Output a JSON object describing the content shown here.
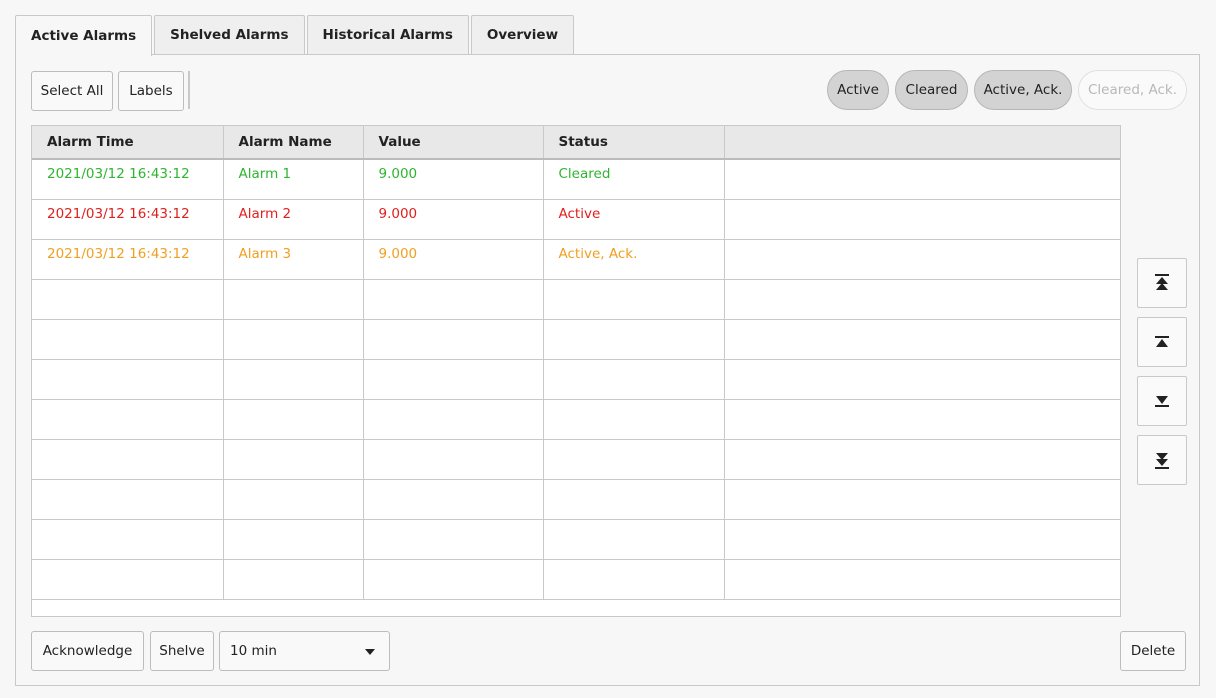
{
  "tabs": [
    "Active Alarms",
    "Shelved Alarms",
    "Historical Alarms",
    "Overview"
  ],
  "toolbar": {
    "select_all": "Select All",
    "labels": "Labels"
  },
  "filters": [
    {
      "label": "Active",
      "enabled": true
    },
    {
      "label": "Cleared",
      "enabled": true
    },
    {
      "label": "Active, Ack.",
      "enabled": true
    },
    {
      "label": "Cleared, Ack.",
      "enabled": false
    }
  ],
  "table": {
    "columns": [
      "Alarm Time",
      "Alarm Name",
      "Value",
      "Status",
      ""
    ],
    "rows": [
      {
        "cells": [
          "2021/03/12 16:43:12",
          "Alarm 1",
          "9.000",
          "Cleared"
        ],
        "color": "#2fb52f"
      },
      {
        "cells": [
          "2021/03/12 16:43:12",
          "Alarm 2",
          "9.000",
          "Active"
        ],
        "color": "#e0201e"
      },
      {
        "cells": [
          "2021/03/12 16:43:12",
          "Alarm 3",
          "9.000",
          "Active, Ack."
        ],
        "color": "#f0a020"
      }
    ]
  },
  "nav_buttons": [
    "first-page-icon",
    "previous-page-icon",
    "next-page-icon",
    "last-page-icon"
  ],
  "footer": {
    "acknowledge": "Acknowledge",
    "shelve": "Shelve",
    "shelve_duration": "10 min",
    "delete": "Delete"
  }
}
